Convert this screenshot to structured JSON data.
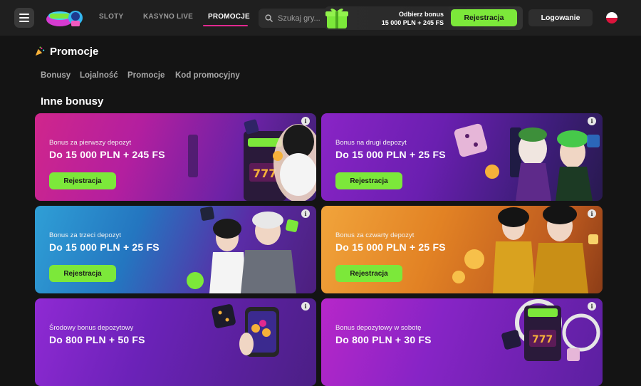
{
  "header": {
    "nav": [
      "SLOTY",
      "KASYNO LIVE",
      "PROMOCJE"
    ],
    "search_placeholder": "Szukaj gry...",
    "promo_line1": "Odbierz bonus",
    "promo_line2": "15 000 PLN + 245 FS",
    "register_label": "Rejestracja",
    "login_label": "Logowanie"
  },
  "page": {
    "title": "Promocje",
    "subnav": [
      "Bonusy",
      "Lojalność",
      "Promocje",
      "Kod promocyjny"
    ],
    "section_title": "Inne bonusy"
  },
  "cards": [
    {
      "subtitle": "Bonus za pierwszy depozyt",
      "amount": "Do 15 000 PLN + 245 FS",
      "cta": "Rejestracja"
    },
    {
      "subtitle": "Bonus na drugi depozyt",
      "amount": "Do 15 000 PLN + 25 FS",
      "cta": "Rejestracja"
    },
    {
      "subtitle": "Bonus za trzeci depozyt",
      "amount": "Do 15 000 PLN + 25 FS",
      "cta": "Rejestracja"
    },
    {
      "subtitle": "Bonus za czwarty depozyt",
      "amount": "Do 15 000 PLN + 25 FS",
      "cta": "Rejestracja"
    },
    {
      "subtitle": "Środowy bonus depozytowy",
      "amount": "Do 800 PLN + 50 FS",
      "cta": ""
    },
    {
      "subtitle": "Bonus depozytowy w sobotę",
      "amount": "Do 800 PLN + 30 FS",
      "cta": ""
    }
  ],
  "icons": {
    "info": "i",
    "title_icon": "party-popper-icon",
    "menu": "menu-icon",
    "search": "search-icon",
    "flag": "poland-flag-icon"
  },
  "colors": {
    "accent_green": "#7ce83a",
    "active_nav": "#e2298f",
    "background": "#141414"
  }
}
